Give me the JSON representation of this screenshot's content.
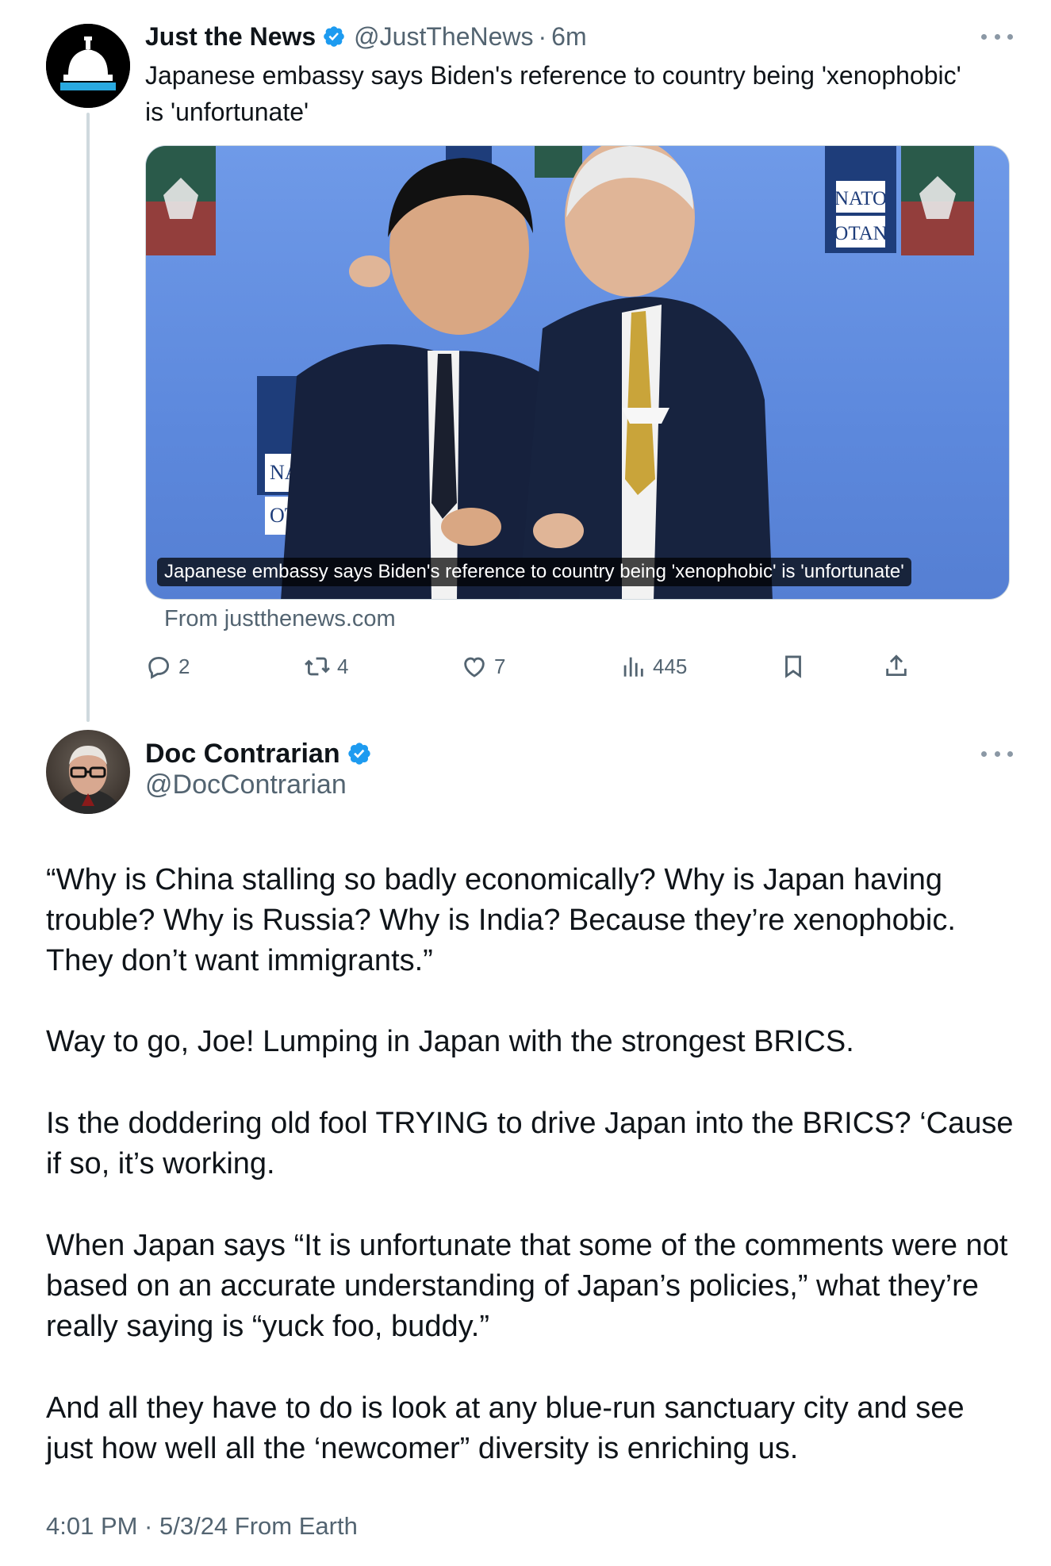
{
  "tweet1": {
    "author_name": "Just the News",
    "handle": "@JustTheNews",
    "separator": "·",
    "time": "6m",
    "text": "Japanese embassy says Biden's reference to country being 'xenophobic' is 'unfortunate'",
    "media_caption": "Japanese embassy says Biden's reference to country being 'xenophobic' is 'unfortunate'",
    "media_signs": [
      "NATO",
      "OTAN",
      "NA",
      "OT"
    ],
    "source": "From justthenews.com",
    "stats": {
      "replies": "2",
      "reposts": "4",
      "likes": "7",
      "views": "445"
    }
  },
  "tweet2": {
    "author_name": "Doc Contrarian",
    "handle": "@DocContrarian",
    "paragraphs": [
      "“Why is China stalling so badly economically? Why is Japan having trouble? Why is Russia? Why is India? Because they’re xenophobic. They don’t want immigrants.”",
      "Way to go, Joe! Lumping in Japan with the strongest BRICS.",
      "Is the doddering old fool TRYING to drive Japan into the BRICS? ‘Cause if so, it’s working.",
      "When Japan says “It is unfortunate that some of the comments were not based on an accurate understanding of Japan’s policies,” what they’re really saying is “yuck foo, buddy.”",
      "And all they have to do is look at any blue-run sanctuary city and see just how well all the ‘newcomer” diversity is enriching us."
    ],
    "timestamp": "4:01 PM · 5/3/24 From Earth"
  },
  "colors": {
    "verified_blue": "#1d9bf0",
    "secondary_text": "#536471",
    "primary_text": "#0f1419",
    "divider": "#cfd9de"
  },
  "icons": {
    "tweet1_avatar": "capitol-dome-icon",
    "reply": "reply-icon",
    "repost": "repost-icon",
    "like": "heart-icon",
    "views": "views-chart-icon",
    "bookmark": "bookmark-icon",
    "share": "share-icon",
    "more": "more-dots-icon",
    "verified": "verified-badge-icon"
  }
}
